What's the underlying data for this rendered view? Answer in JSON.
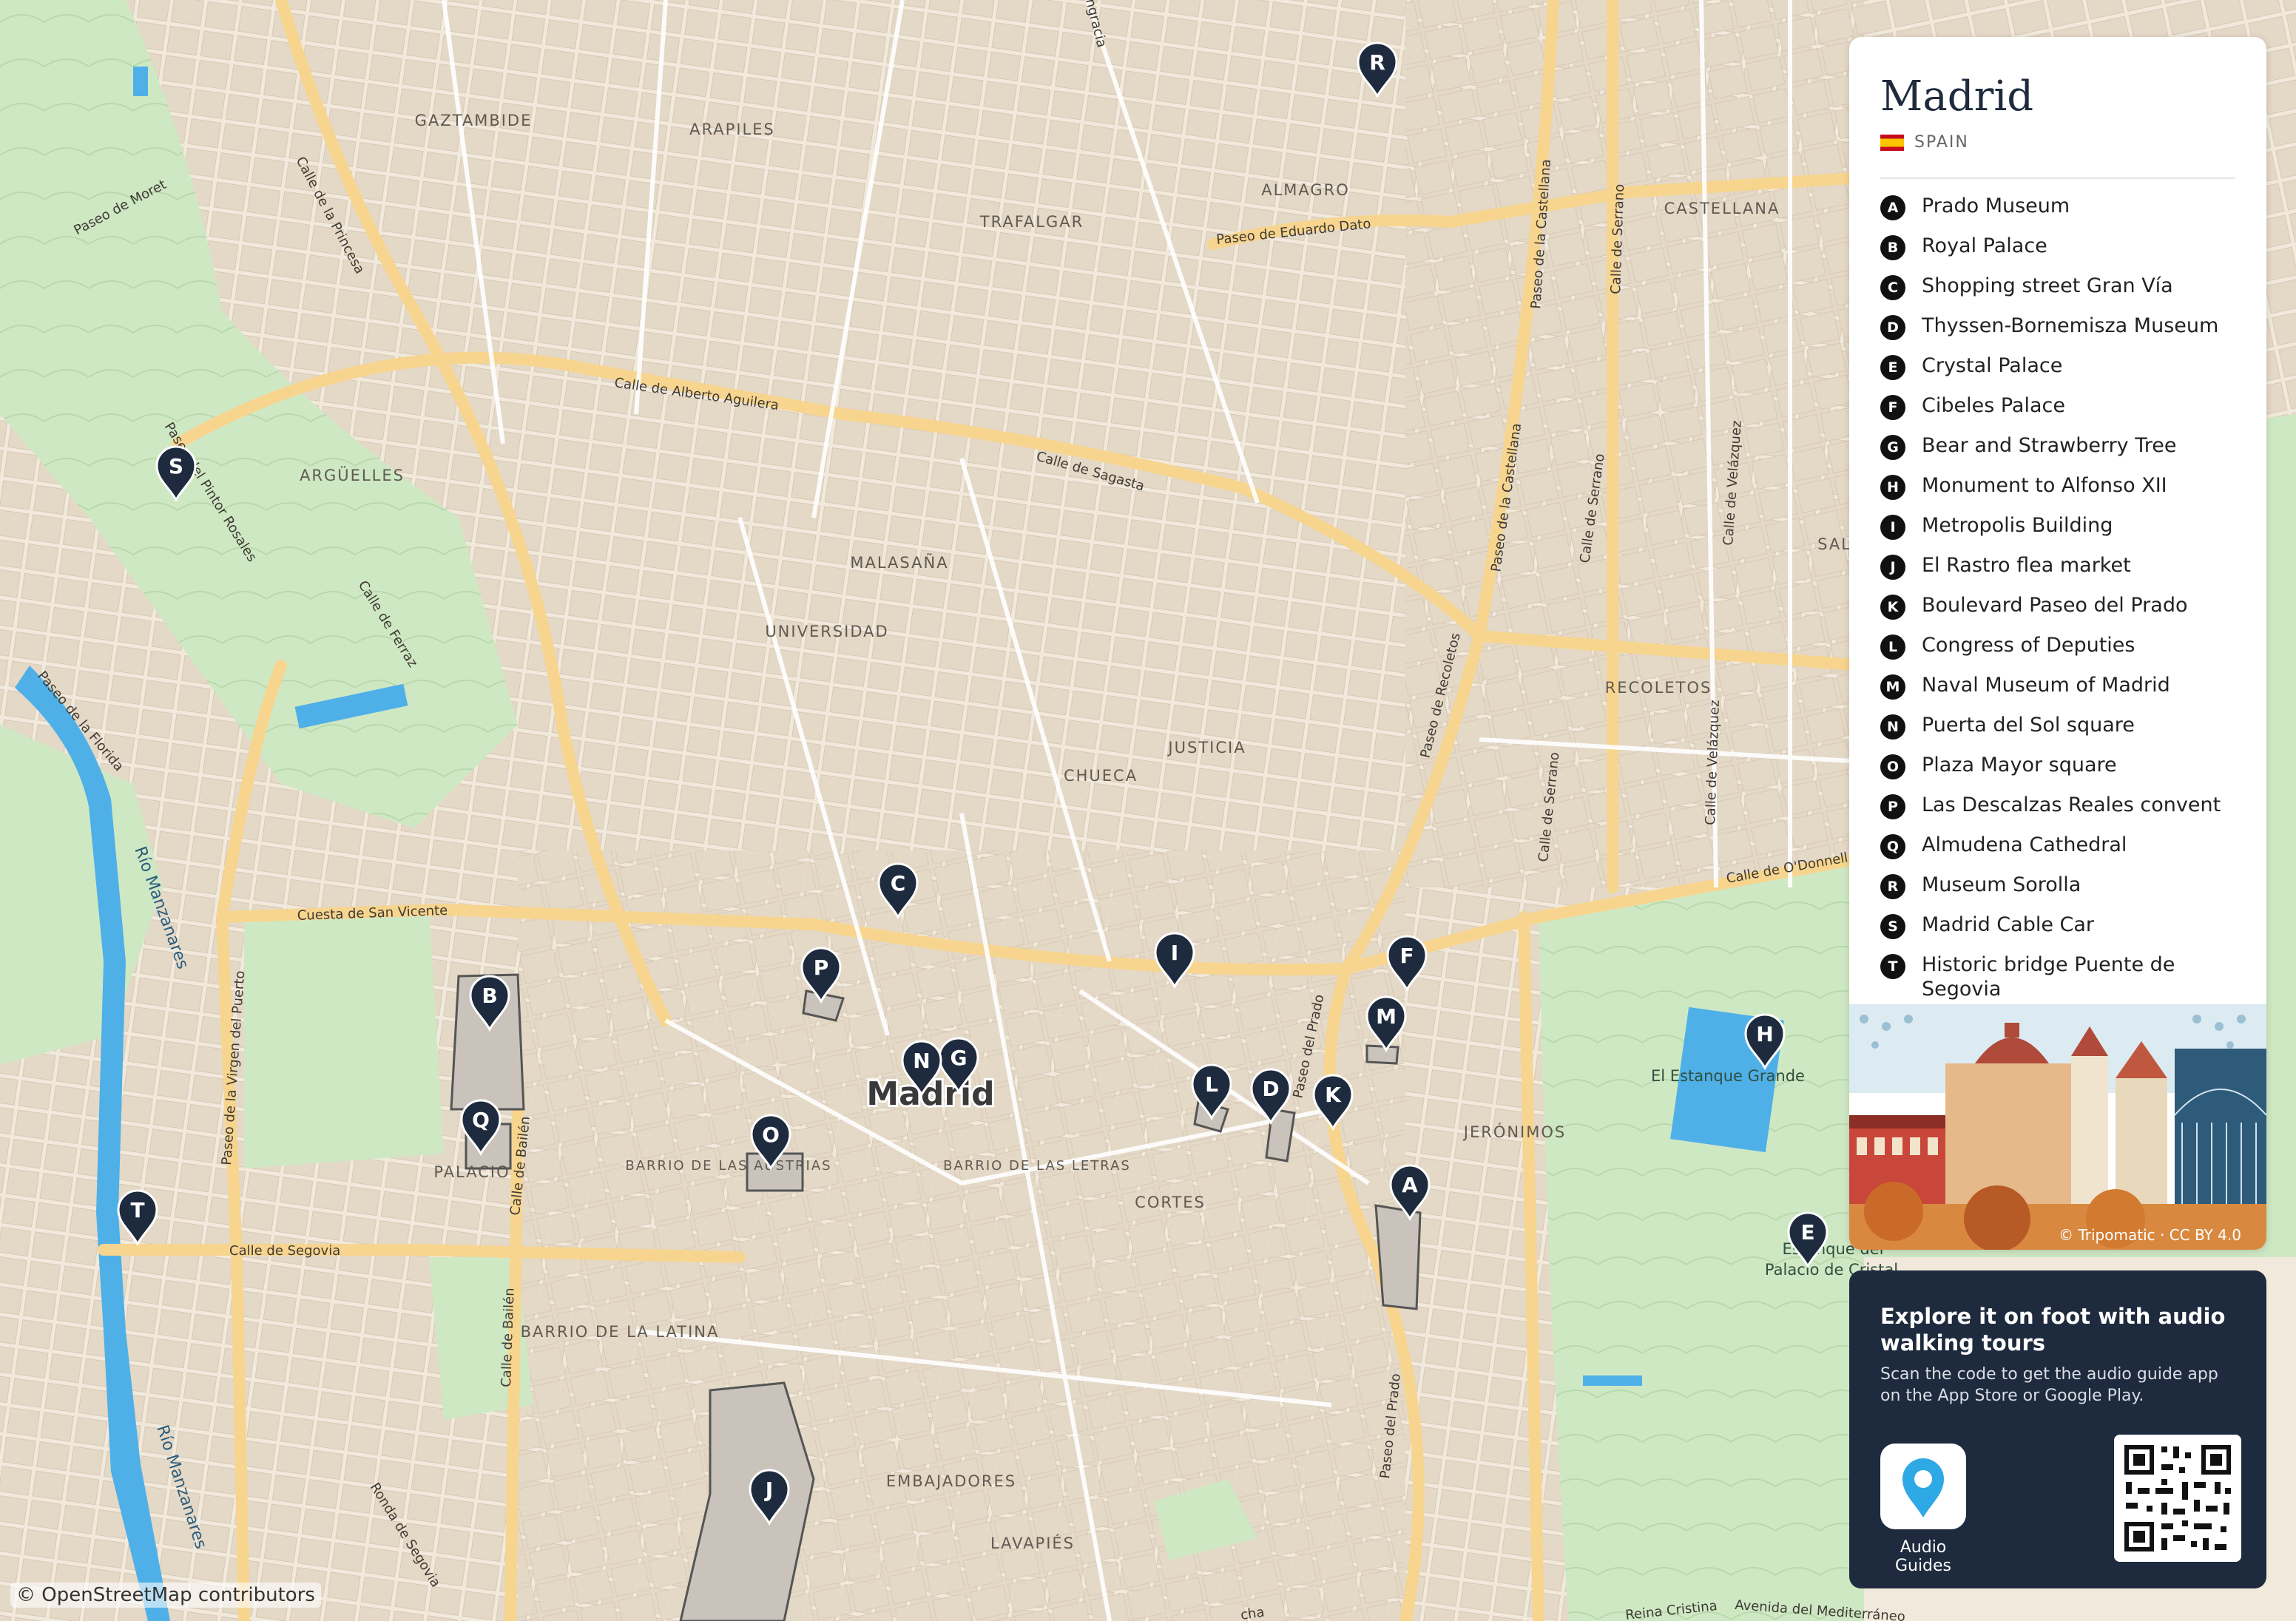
{
  "map": {
    "districts": [
      "GAZTAMBIDE",
      "ARAPILES",
      "ALMAGRO",
      "TRAFALGAR",
      "CASTELLANA",
      "ARGÜELLES",
      "MALASAÑA",
      "UNIVERSIDAD",
      "JUSTICIA",
      "CHUECA",
      "RECOLETOS",
      "SAL",
      "PALACIO",
      "BARRIO DE LAS AUSTRIAS",
      "BARRIO DE LAS LETRAS",
      "CORTES",
      "JERÓNIMOS",
      "BARRIO DE LA LATINA",
      "EMBAJADORES",
      "LAVAPIÉS"
    ],
    "streets": [
      "Paseo de Moret",
      "Calle de la Princesa",
      "Calle de Alberto Aguilera",
      "Paseo de Eduardo Dato",
      "Paseo de la Castellana",
      "Calle de Serrano",
      "Calle de Sagasta",
      "Paseo del Pintor Rosales",
      "Calle de Ferraz",
      "Paseo de la Florida",
      "Paseo de Recoletos",
      "Calle de Velázquez",
      "Calle de O'Donnell",
      "Cuesta de San Vicente",
      "Paseo de la Virgen del Puerto",
      "Calle de Bailén",
      "Calle de Segovia",
      "Ronda de Segovia",
      "Paseo del Prado",
      "Avenida del Mediterráneo",
      "Calle de Serrano",
      "Calle de Velázquez",
      "Calle de Serrano",
      "Paseo de la Castellana",
      "Calle de Bailén",
      "Paseo del Prado",
      "ngracia",
      "Reina Cristina",
      "cha"
    ],
    "rivers": [
      "Río Manzanares",
      "Río Manzanares"
    ],
    "parks": [
      "El Estanque Grande",
      "Palacio de Cristal"
    ],
    "park_prefix": "Estanque del",
    "city_label": "Madrid",
    "pins": [
      "A",
      "B",
      "C",
      "D",
      "E",
      "F",
      "G",
      "H",
      "I",
      "J",
      "K",
      "L",
      "M",
      "N",
      "O",
      "P",
      "Q",
      "R",
      "S",
      "T"
    ],
    "attribution": "© OpenStreetMap contributors"
  },
  "panel": {
    "title": "Madrid",
    "country": "SPAIN",
    "pois": [
      {
        "letter": "A",
        "name": "Prado Museum"
      },
      {
        "letter": "B",
        "name": "Royal Palace"
      },
      {
        "letter": "C",
        "name": "Shopping street Gran Vía"
      },
      {
        "letter": "D",
        "name": "Thyssen-Bornemisza Museum"
      },
      {
        "letter": "E",
        "name": "Crystal Palace"
      },
      {
        "letter": "F",
        "name": "Cibeles Palace"
      },
      {
        "letter": "G",
        "name": "Bear and Strawberry Tree"
      },
      {
        "letter": "H",
        "name": "Monument to Alfonso XII"
      },
      {
        "letter": "I",
        "name": "Metropolis Building"
      },
      {
        "letter": "J",
        "name": "El Rastro flea market"
      },
      {
        "letter": "K",
        "name": "Boulevard Paseo del Prado"
      },
      {
        "letter": "L",
        "name": "Congress of Deputies"
      },
      {
        "letter": "M",
        "name": "Naval Museum of Madrid"
      },
      {
        "letter": "N",
        "name": "Puerta del Sol square"
      },
      {
        "letter": "O",
        "name": "Plaza Mayor square"
      },
      {
        "letter": "P",
        "name": "Las Descalzas Reales convent"
      },
      {
        "letter": "Q",
        "name": "Almudena Cathedral"
      },
      {
        "letter": "R",
        "name": "Museum Sorolla"
      },
      {
        "letter": "S",
        "name": "Madrid Cable Car"
      },
      {
        "letter": "T",
        "name": "Historic bridge Puente de Segovia"
      }
    ],
    "illustration_credit": "© Tripomatic · CC BY 4.0"
  },
  "promo": {
    "heading": "Explore it on foot with audio walking tours",
    "text": "Scan the code to get the audio guide app on the App Store or Google Play.",
    "app_label": "Audio Guides"
  },
  "colors": {
    "land": "#f1e9dc",
    "blocks": "#e2d6c5",
    "park": "#cfe8c4",
    "water": "#4fb0e8",
    "main_road": "#f7d58f",
    "pin": "#1e2a3d",
    "panel_dark": "#1e2a3d"
  }
}
